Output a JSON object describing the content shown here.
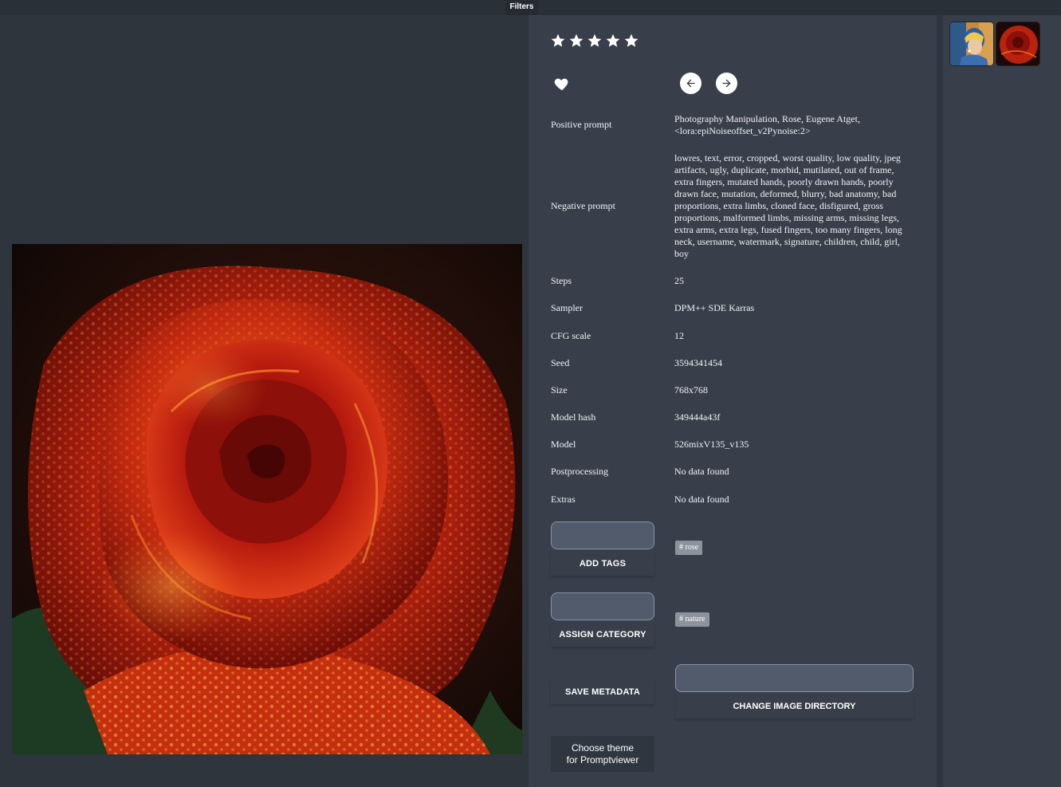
{
  "top_bar": {
    "filters_label": "Filters"
  },
  "rating": {
    "stars": 5,
    "max": 5,
    "star_icon": "star-icon"
  },
  "actions": {
    "favorite_icon": "heart-icon",
    "prev_icon": "arrow-left-icon",
    "next_icon": "arrow-right-icon"
  },
  "metadata": {
    "positive_prompt": {
      "label": "Positive prompt",
      "value": "Photography Manipulation, Rose, Eugene Atget, <lora:epiNoiseoffset_v2Pynoise:2>"
    },
    "negative_prompt": {
      "label": "Negative prompt",
      "value": "lowres, text, error, cropped, worst quality, low quality, jpeg artifacts, ugly, duplicate, morbid, mutilated, out of frame, extra fingers, mutated hands, poorly drawn hands, poorly drawn face, mutation, deformed, blurry, bad anatomy, bad proportions, extra limbs, cloned face, disfigured, gross proportions, malformed limbs, missing arms, missing legs, extra arms, extra legs, fused fingers, too many fingers, long neck, username, watermark, signature, children, child, girl, boy"
    },
    "steps": {
      "label": "Steps",
      "value": "25"
    },
    "sampler": {
      "label": "Sampler",
      "value": "DPM++ SDE Karras"
    },
    "cfg_scale": {
      "label": "CFG scale",
      "value": "12"
    },
    "seed": {
      "label": "Seed",
      "value": "3594341454"
    },
    "size": {
      "label": "Size",
      "value": "768x768"
    },
    "model_hash": {
      "label": "Model hash",
      "value": "349444a43f"
    },
    "model": {
      "label": "Model",
      "value": "526mixV135_v135"
    },
    "postprocessing": {
      "label": "Postprocessing",
      "value": "No data found"
    },
    "extras": {
      "label": "Extras",
      "value": "No data found"
    }
  },
  "tags": {
    "add_tags_label": "ADD TAGS",
    "tag_chip": "# rose",
    "assign_category_label": "ASSIGN CATEGORY",
    "category_chip": "# nature"
  },
  "buttons": {
    "save_metadata": "SAVE METADATA",
    "change_directory": "CHANGE IMAGE DIRECTORY",
    "choose_theme_line1": "Choose theme",
    "choose_theme_line2": "for Promptviewer"
  },
  "thumbnails": [
    {
      "name": "thumbnail-girl-with-pearl-earring"
    },
    {
      "name": "thumbnail-red-rose"
    }
  ]
}
